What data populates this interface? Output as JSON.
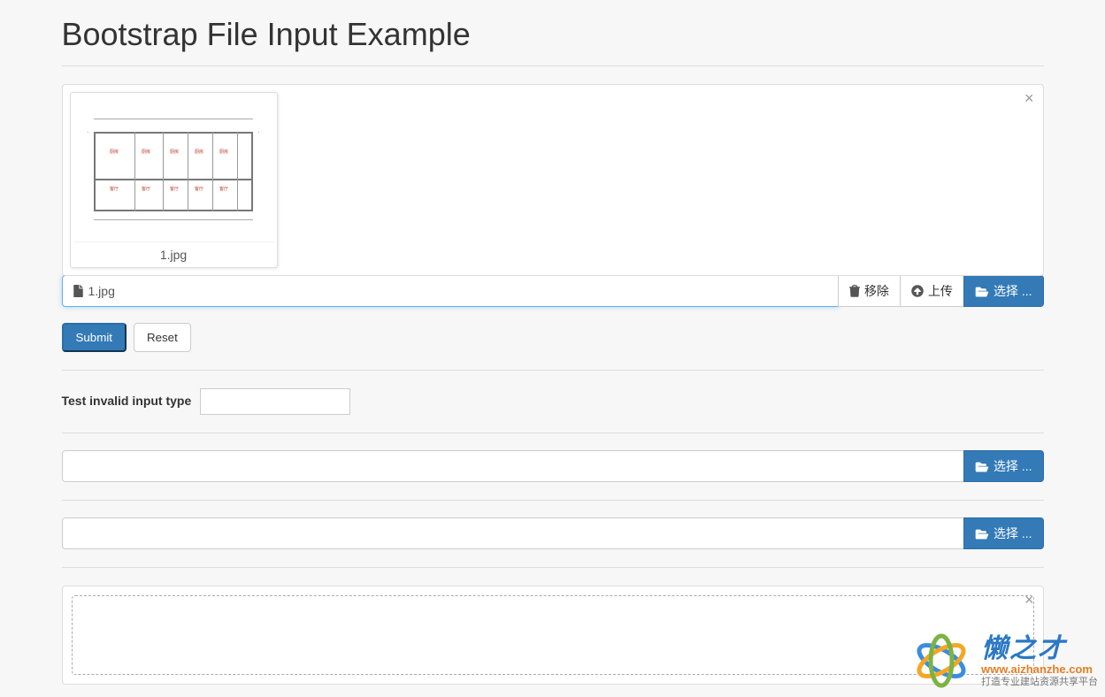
{
  "page_title": "Bootstrap File Input Example",
  "file_input_1": {
    "preview_filename": "1.jpg",
    "caption_filename": "1.jpg",
    "remove_label": "移除",
    "upload_label": "上传",
    "browse_label": "选择 ..."
  },
  "form_actions": {
    "submit_label": "Submit",
    "reset_label": "Reset"
  },
  "invalid_input": {
    "label": "Test invalid input type",
    "value": ""
  },
  "file_input_2": {
    "caption_filename": "",
    "browse_label": "选择 ..."
  },
  "file_input_3": {
    "caption_filename": "",
    "browse_label": "选择 ..."
  },
  "dropzone": {
    "placeholder": ""
  },
  "watermark": {
    "title": "懒之才",
    "url": "www.aizhanzhe.com",
    "subtitle": "打造专业建站资源共享平台"
  }
}
